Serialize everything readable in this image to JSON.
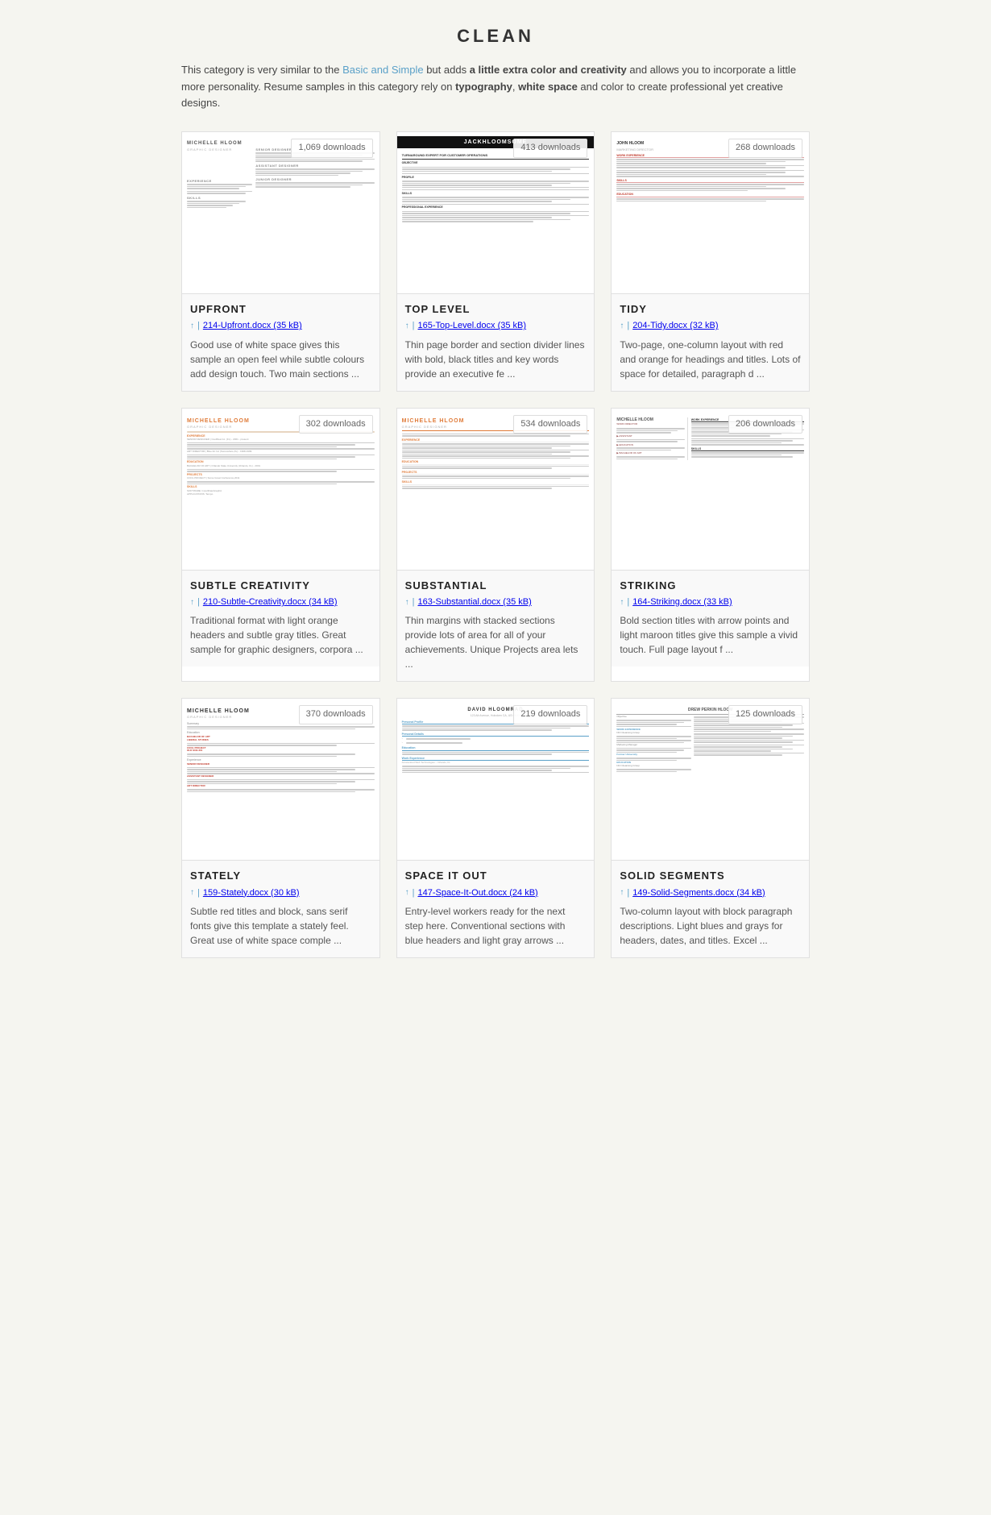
{
  "page": {
    "title": "CLEAN",
    "description_parts": [
      "This category is very similar to the ",
      "Basic and Simple",
      " but adds ",
      "a little extra color and creativity",
      " and allows you to incorporate a little more personality. Resume samples in this category rely on ",
      "typography",
      ", ",
      "white space",
      " and color to create professional yet creative designs."
    ]
  },
  "resumes": [
    {
      "id": "upfront",
      "name": "UPFRONT",
      "file": "214-Upfront.docx (35 kB)",
      "downloads": "1,069 downloads",
      "description": "Good use of white space gives this sample an open feel while subtle colours add design touch. Two main sections ...",
      "style": "upfront"
    },
    {
      "id": "top-level",
      "name": "TOP LEVEL",
      "file": "165-Top-Level.docx (35 kB)",
      "downloads": "413 downloads",
      "description": "Thin page border and section divider lines with bold, black titles and key words provide an executive fe ...",
      "style": "toplevel"
    },
    {
      "id": "tidy",
      "name": "TIDY",
      "file": "204-Tidy.docx (32 kB)",
      "downloads": "268 downloads",
      "description": "Two-page, one-column layout with red and orange for headings and titles. Lots of space for detailed, paragraph d ...",
      "style": "tidy"
    },
    {
      "id": "subtle-creativity",
      "name": "SUBTLE CREATIVITY",
      "file": "210-Subtle-Creativity.docx (34 kB)",
      "downloads": "302 downloads",
      "description": "Traditional format with light orange headers and subtle gray titles. Great sample for graphic designers, corpora ...",
      "style": "subtle"
    },
    {
      "id": "substantial",
      "name": "SUBSTANTIAL",
      "file": "163-Substantial.docx (35 kB)",
      "downloads": "534 downloads",
      "description": "Thin margins with stacked sections provide lots of area for all of your achievements. Unique Projects area lets ...",
      "style": "substantial"
    },
    {
      "id": "striking",
      "name": "STRIKING",
      "file": "164-Striking.docx (33 kB)",
      "downloads": "206 downloads",
      "description": "Bold section titles with arrow points and light maroon titles give this sample a vivid touch. Full page layout f ...",
      "style": "striking"
    },
    {
      "id": "stately",
      "name": "STATELY",
      "file": "159-Stately.docx (30 kB)",
      "downloads": "370 downloads",
      "description": "Subtle red titles and block, sans serif fonts give this template a stately feel. Great use of white space comple ...",
      "style": "stately"
    },
    {
      "id": "space-it-out",
      "name": "SPACE IT OUT",
      "file": "147-Space-It-Out.docx (24 kB)",
      "downloads": "219 downloads",
      "description": "Entry-level workers ready for the next step here. Conventional sections with blue headers and light gray arrows ...",
      "style": "spaceitout"
    },
    {
      "id": "solid-segments",
      "name": "SOLID SEGMENTS",
      "file": "149-Solid-Segments.docx (34 kB)",
      "downloads": "125 downloads",
      "description": "Two-column layout with block paragraph descriptions. Light blues and grays for headers, dates, and titles. Excel ...",
      "style": "solid"
    }
  ]
}
